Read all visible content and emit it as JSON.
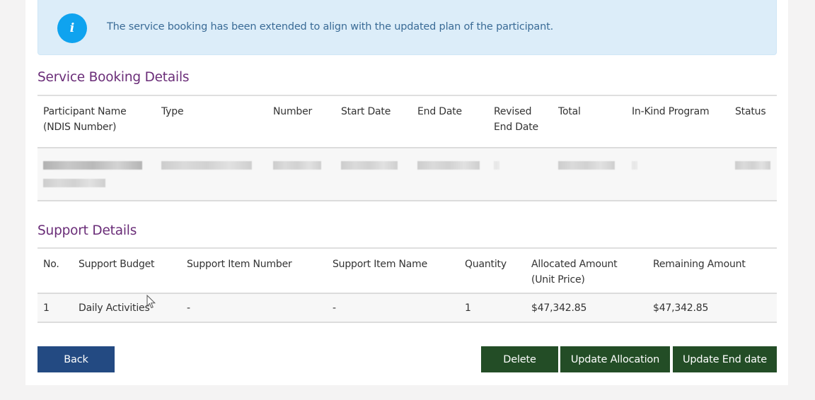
{
  "alert": {
    "icon": "info-icon",
    "icon_glyph": "i",
    "message": "The service booking has been extended to align with the updated plan of the participant."
  },
  "service_booking": {
    "title": "Service Booking Details",
    "columns": [
      "Participant Name (NDIS Number)",
      "Type",
      "Number",
      "Start Date",
      "End Date",
      "Revised End Date",
      "Total",
      "In-Kind Program",
      "Status"
    ],
    "column_lines": [
      [
        "Participant Name",
        "(NDIS Number)"
      ],
      [
        "Type"
      ],
      [
        "Number"
      ],
      [
        "Start Date"
      ],
      [
        "End Date"
      ],
      [
        "Revised",
        "End Date"
      ],
      [
        "Total"
      ],
      [
        "In-Kind Program"
      ],
      [
        "Status"
      ]
    ],
    "rows_redacted": true
  },
  "support_details": {
    "title": "Support Details",
    "columns": [
      "No.",
      "Support Budget",
      "Support Item Number",
      "Support Item Name",
      "Quantity",
      "Allocated Amount (Unit Price)",
      "Remaining Amount"
    ],
    "column_lines": [
      [
        "No."
      ],
      [
        "Support Budget"
      ],
      [
        "Support Item Number"
      ],
      [
        "Support Item Name"
      ],
      [
        "Quantity"
      ],
      [
        "Allocated Amount",
        "(Unit Price)"
      ],
      [
        "Remaining Amount"
      ]
    ],
    "rows": [
      {
        "no": "1",
        "support_budget": "Daily Activities",
        "support_item_number": "-",
        "support_item_name": "-",
        "quantity": "1",
        "allocated_amount": "$47,342.85",
        "remaining_amount": "$47,342.85"
      }
    ]
  },
  "actions": {
    "back": "Back",
    "delete": "Delete",
    "update_allocation": "Update Allocation",
    "update_end_date": "Update End date"
  },
  "colors": {
    "section_title": "#6a2d78",
    "alert_bg": "#dcedf9",
    "alert_icon": "#0fa3ef",
    "back_button": "#234a82",
    "action_button": "#234d26"
  }
}
